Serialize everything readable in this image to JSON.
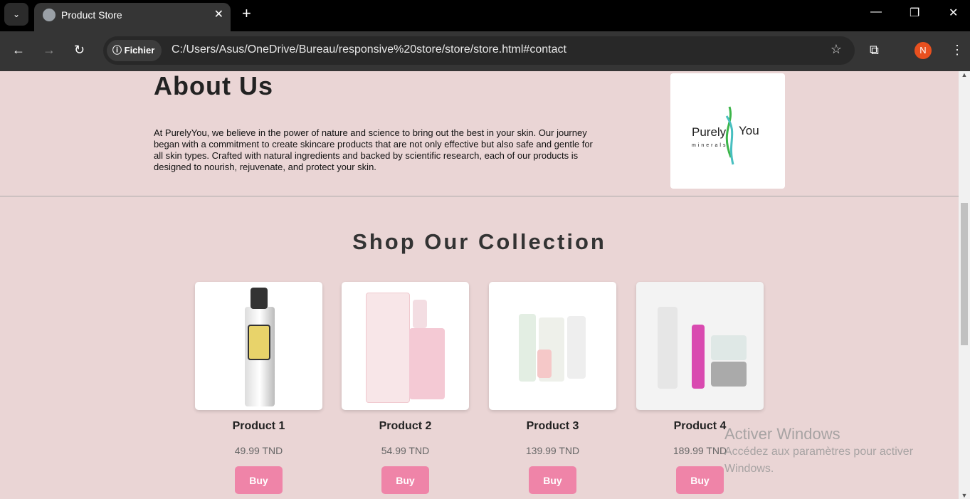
{
  "browser": {
    "tab_title": "Product Store",
    "security_chip": "Fichier",
    "url": "C:/Users/Asus/OneDrive/Bureau/responsive%20store/store/store.html#contact",
    "profile_initial": "N"
  },
  "about": {
    "title": "About Us",
    "text": "At PurelyYou, we believe in the power of nature and science to bring out the best in your skin. Our journey began with a commitment to create skincare products that are not only effective but also safe and gentle for all skin types. Crafted with natural ingredients and backed by scientific research, each of our products is designed to nourish, rejuvenate, and protect your skin.",
    "logo_text": "PurelyYou minerals"
  },
  "shop": {
    "title": "Shop Our Collection",
    "buy_label": "Buy",
    "products": [
      {
        "name": "Product 1",
        "price": "49.99 TND"
      },
      {
        "name": "Product 2",
        "price": "54.99 TND"
      },
      {
        "name": "Product 3",
        "price": "139.99 TND"
      },
      {
        "name": "Product 4",
        "price": "189.99 TND"
      }
    ]
  },
  "watermark": {
    "title": "Activer Windows",
    "subtitle": "Accédez aux paramètres pour activer Windows."
  },
  "colors": {
    "background": "#ead5d5",
    "buy_button": "#ef84a8"
  }
}
